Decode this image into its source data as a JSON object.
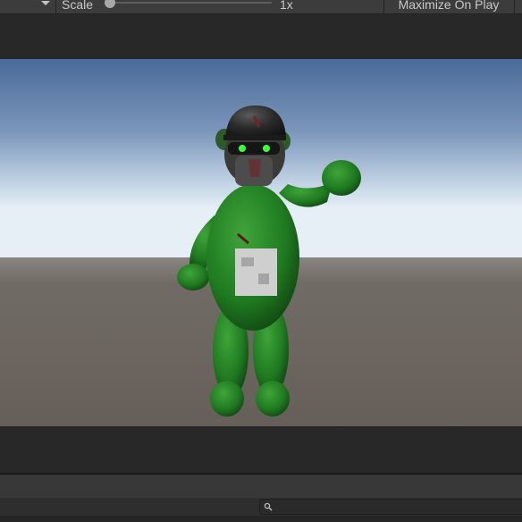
{
  "toolbar": {
    "scale_label": "Scale",
    "zoom_value": "1x",
    "zoom_level": 1,
    "maximize_label": "Maximize On Play"
  },
  "viewport": {
    "character": "green plush bear with black helmet and waving arm",
    "sky_color_top": "#4a6a98",
    "horizon_color": "#e4eef6",
    "ground_color": "#6b6560"
  },
  "search": {
    "placeholder": ""
  },
  "icons": [
    "chevron-down-icon",
    "search-icon"
  ]
}
